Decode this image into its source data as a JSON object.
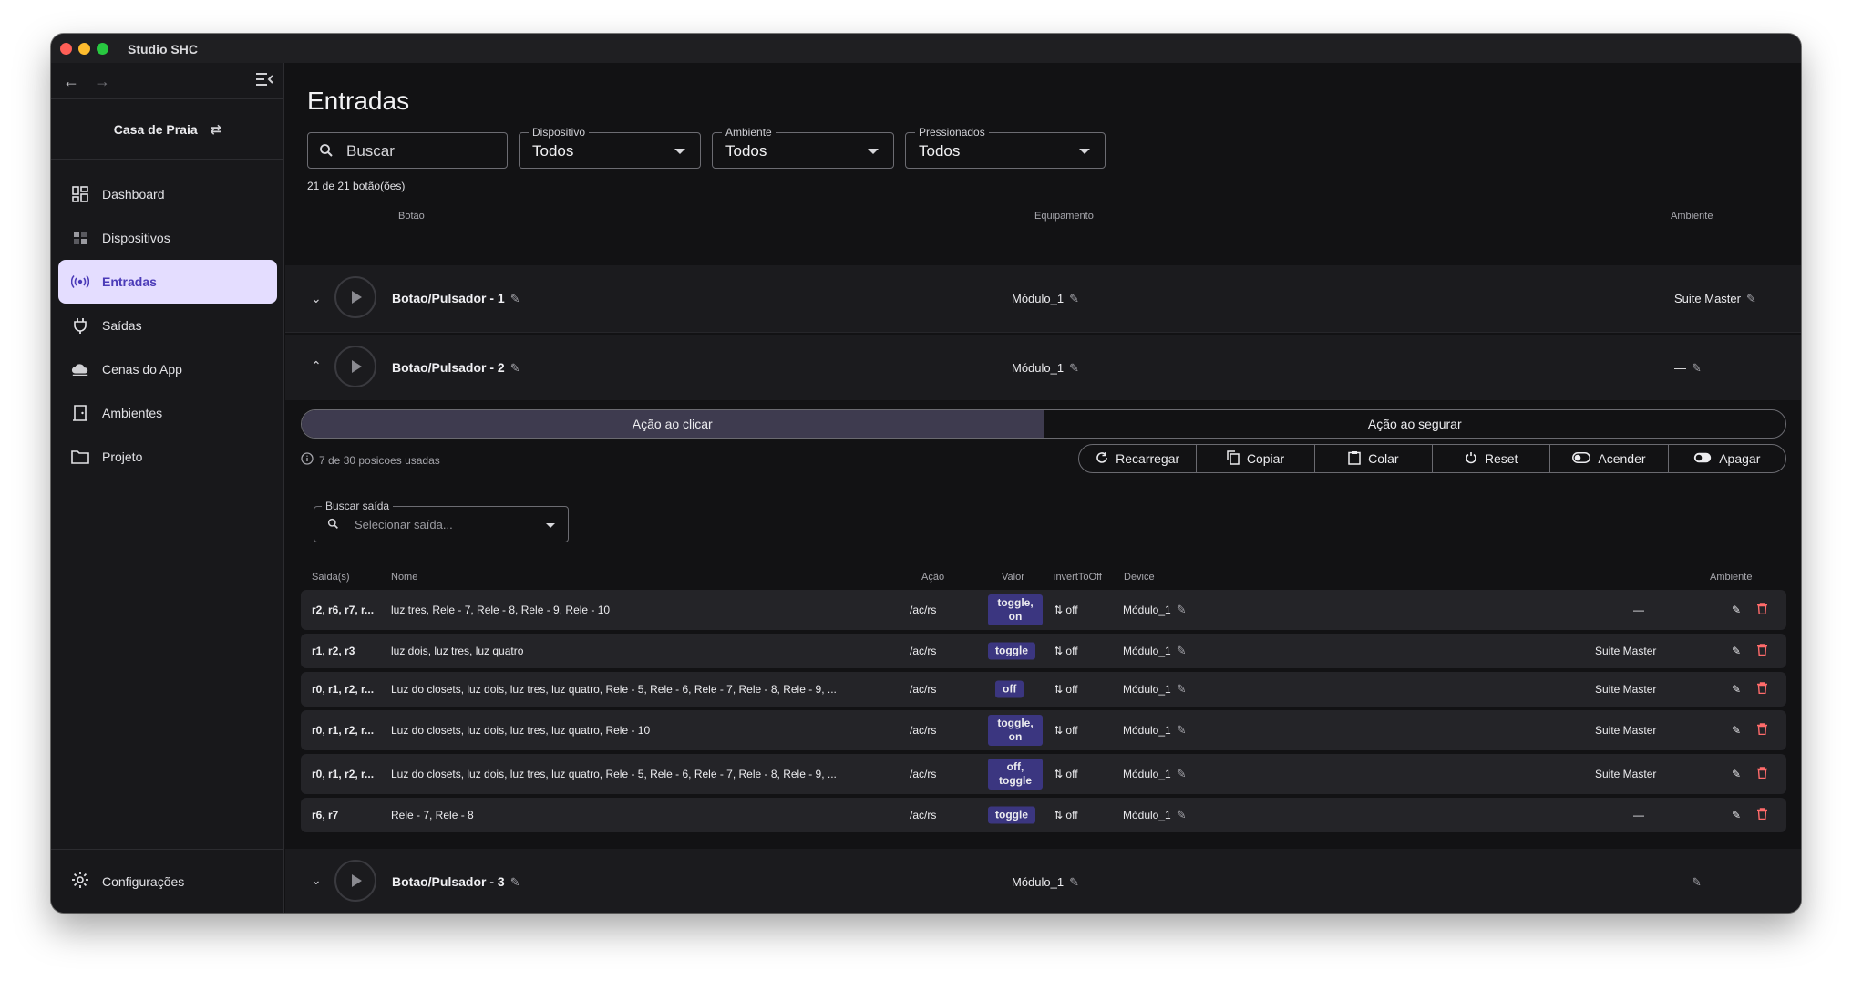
{
  "window": {
    "title": "Studio SHC"
  },
  "sidebar": {
    "house": "Casa de Praia",
    "items": [
      {
        "label": "Dashboard",
        "icon": "grid-icon"
      },
      {
        "label": "Dispositivos",
        "icon": "devices-icon"
      },
      {
        "label": "Entradas",
        "icon": "broadcast-icon",
        "active": true
      },
      {
        "label": "Saídas",
        "icon": "plug-icon"
      },
      {
        "label": "Cenas do App",
        "icon": "cloud-icon"
      },
      {
        "label": "Ambientes",
        "icon": "door-icon"
      },
      {
        "label": "Projeto",
        "icon": "folder-icon"
      }
    ],
    "settings": "Configurações"
  },
  "main": {
    "title": "Entradas",
    "filters": {
      "search_placeholder": "Buscar",
      "dispositivo_label": "Dispositivo",
      "dispositivo_value": "Todos",
      "ambiente_label": "Ambiente",
      "ambiente_value": "Todos",
      "pressionados_label": "Pressionados",
      "pressionados_value": "Todos"
    },
    "count": "21 de 21 botão(ões)",
    "headers": {
      "botao": "Botão",
      "equipamento": "Equipamento",
      "ambiente": "Ambiente"
    },
    "buttons": [
      {
        "name": "Botao/Pulsador - 1",
        "equip": "Módulo_1",
        "ambiente": "Suite Master"
      },
      {
        "name": "Botao/Pulsador - 2",
        "equip": "Módulo_1",
        "ambiente": "—"
      },
      {
        "name": "Botao/Pulsador - 3",
        "equip": "Módulo_1",
        "ambiente": "—"
      }
    ],
    "detail": {
      "tab_click": "Ação ao clicar",
      "tab_hold": "Ação ao segurar",
      "usage": "7 de 30 posicoes usadas",
      "actions": [
        "Recarregar",
        "Copiar",
        "Colar",
        "Reset",
        "Acender",
        "Apagar"
      ],
      "search_label": "Buscar saída",
      "search_placeholder": "Selecionar saída...",
      "headers": {
        "saidas": "Saída(s)",
        "nome": "Nome",
        "acao": "Ação",
        "valor": "Valor",
        "invert": "invertToOff",
        "device": "Device",
        "ambiente": "Ambiente"
      },
      "rows": [
        {
          "saidas": "r2, r6, r7, r...",
          "nome": "luz tres, Rele - 7, Rele - 8, Rele - 9, Rele - 10",
          "acao": "/ac/rs",
          "valor": "toggle, on",
          "invert": "off",
          "device": "Módulo_1",
          "ambiente": "—"
        },
        {
          "saidas": "r1, r2, r3",
          "nome": "luz dois, luz tres, luz quatro",
          "acao": "/ac/rs",
          "valor": "toggle",
          "invert": "off",
          "device": "Módulo_1",
          "ambiente": "Suite Master"
        },
        {
          "saidas": "r0, r1, r2, r...",
          "nome": "Luz do closets, luz dois, luz tres, luz quatro, Rele - 5, Rele - 6, Rele - 7, Rele - 8, Rele - 9, ...",
          "acao": "/ac/rs",
          "valor": "off",
          "invert": "off",
          "device": "Módulo_1",
          "ambiente": "Suite Master"
        },
        {
          "saidas": "r0, r1, r2, r...",
          "nome": "Luz do closets, luz dois, luz tres, luz quatro, Rele - 10",
          "acao": "/ac/rs",
          "valor": "toggle, on",
          "invert": "off",
          "device": "Módulo_1",
          "ambiente": "Suite Master"
        },
        {
          "saidas": "r0, r1, r2, r...",
          "nome": "Luz do closets, luz dois, luz tres, luz quatro, Rele - 5, Rele - 6, Rele - 7, Rele - 8, Rele - 9, ...",
          "acao": "/ac/rs",
          "valor": "off, toggle",
          "invert": "off",
          "device": "Módulo_1",
          "ambiente": "Suite Master"
        },
        {
          "saidas": "r6, r7",
          "nome": "Rele - 7, Rele - 8",
          "acao": "/ac/rs",
          "valor": "toggle",
          "invert": "off",
          "device": "Módulo_1",
          "ambiente": "—"
        }
      ]
    }
  },
  "colors": {
    "accent": "#7b63ff",
    "active_bg": "#e4ddff",
    "chip": "#3b3680",
    "delete": "#ff6b6b"
  }
}
